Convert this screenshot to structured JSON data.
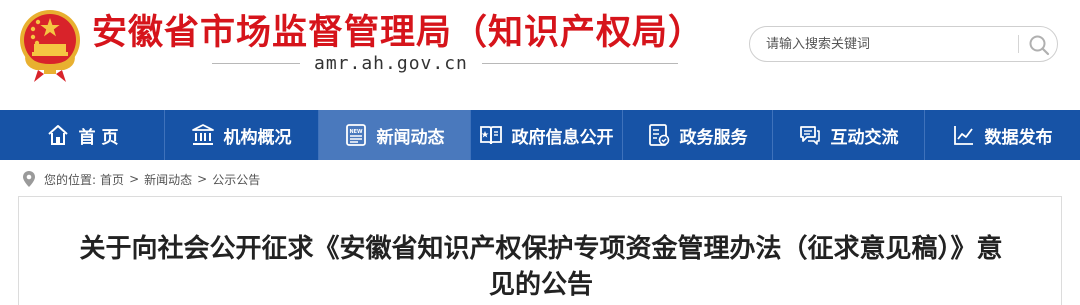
{
  "header": {
    "title": "安徽省市场监督管理局（知识产权局）",
    "domain": "amr.ah.gov.cn",
    "emblem_icon": "national-emblem-icon"
  },
  "search": {
    "placeholder": "请输入搜索关键词",
    "icon": "search-icon"
  },
  "nav": {
    "items": [
      {
        "label": "首 页",
        "icon": "home-icon"
      },
      {
        "label": "机构概况",
        "icon": "institution-icon"
      },
      {
        "label": "新闻动态",
        "icon": "news-icon",
        "active": true
      },
      {
        "label": "政府信息公开",
        "icon": "open-book-icon"
      },
      {
        "label": "政务服务",
        "icon": "service-document-icon"
      },
      {
        "label": "互动交流",
        "icon": "chat-icon"
      },
      {
        "label": "数据发布",
        "icon": "chart-icon"
      }
    ]
  },
  "breadcrumb": {
    "prefix": "您的位置:",
    "items": [
      "首页",
      "新闻动态",
      "公示公告"
    ],
    "separator": ">"
  },
  "article": {
    "title": "关于向社会公开征求《安徽省知识产权保护专项资金管理办法（征求意见稿）》意见的公告"
  },
  "colors": {
    "brand_red": "#d6141b",
    "nav_blue": "#1753a6",
    "nav_active": "#4a79bd"
  }
}
